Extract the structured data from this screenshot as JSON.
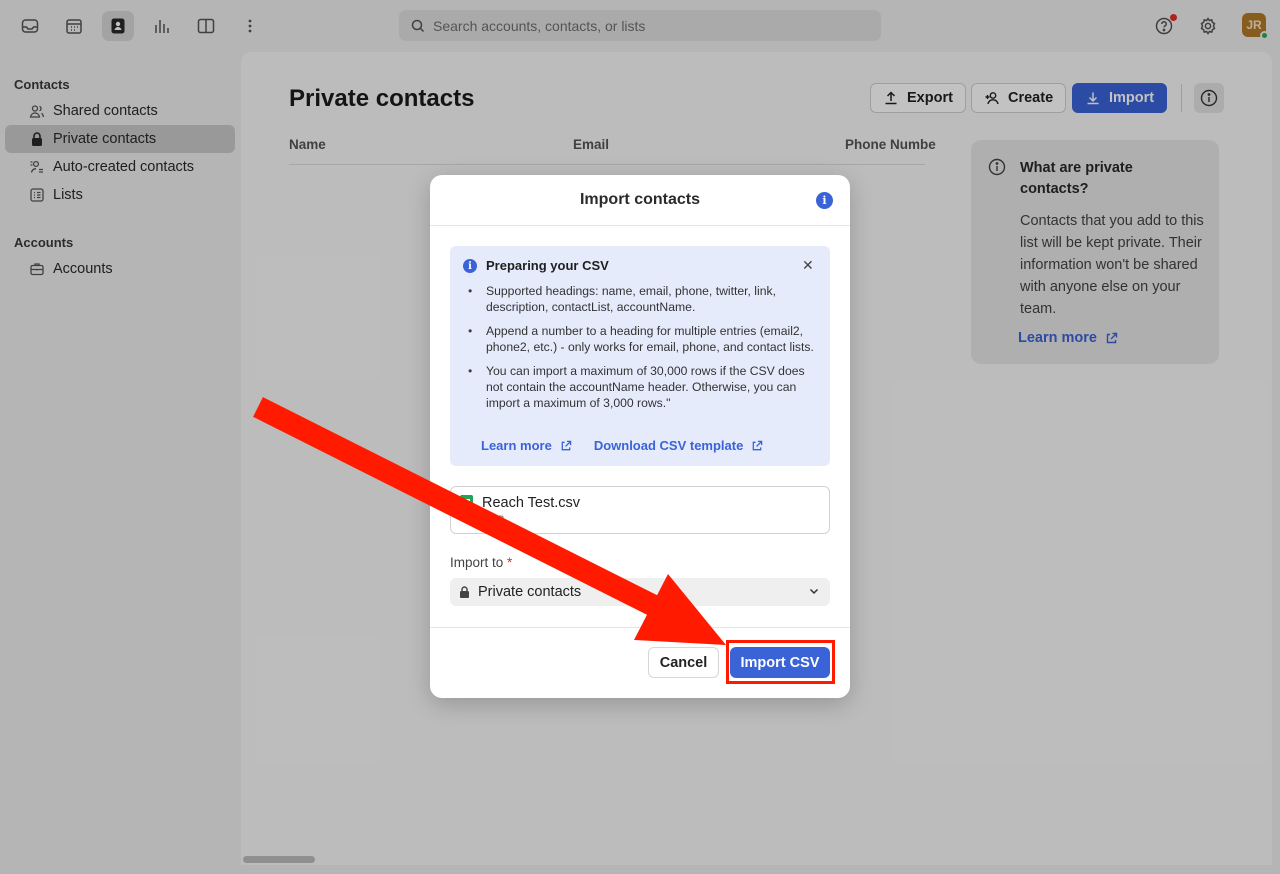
{
  "topbar": {
    "search_placeholder": "Search accounts, contacts, or lists",
    "avatar_initials": "JR",
    "nav_icons": [
      "inbox-icon",
      "calendar-icon",
      "contacts-icon",
      "analytics-icon",
      "split-view-icon",
      "more-vertical-icon"
    ],
    "right_icons": [
      "help-icon",
      "settings-icon"
    ]
  },
  "sidebar": {
    "contacts_heading": "Contacts",
    "contacts_items": [
      {
        "label": "Shared contacts",
        "icon": "users-icon"
      },
      {
        "label": "Private contacts",
        "icon": "lock-icon",
        "active": true
      },
      {
        "label": "Auto-created contacts",
        "icon": "auto-users-icon"
      },
      {
        "label": "Lists",
        "icon": "list-icon"
      }
    ],
    "accounts_heading": "Accounts",
    "accounts_items": [
      {
        "label": "Accounts",
        "icon": "briefcase-icon"
      }
    ]
  },
  "main": {
    "title": "Private contacts",
    "export_label": "Export",
    "create_label": "Create",
    "import_label": "Import",
    "columns": [
      "Name",
      "Email",
      "Phone Numbe"
    ],
    "info_card": {
      "title": "What are private contacts?",
      "body": "Contacts that you add to this list will be kept private. Their information won't be shared with anyone else on your team.",
      "link": "Learn more"
    }
  },
  "modal": {
    "title": "Import contacts",
    "csv_box": {
      "title": "Preparing your CSV",
      "bullets": [
        "Supported headings: name, email, phone, twitter, link, description, contactList, accountName.",
        "Append a number to a heading for multiple entries (email2, phone2, etc.) - only works for email, phone, and contact lists.",
        "You can import a maximum of 30,000 rows if the CSV does not contain the accountName header. Otherwise, you can import a maximum of 3,000 rows.\""
      ],
      "learn_more": "Learn more",
      "download_template": "Download CSV template"
    },
    "file": {
      "name": "Reach Test.csv",
      "size": "1MB"
    },
    "import_to_label": "Import to",
    "required_mark": "*",
    "select_value": "Private contacts",
    "cancel_label": "Cancel",
    "import_csv_label": "Import CSV"
  },
  "colors": {
    "accent": "#3b63d8",
    "annotation": "#ff1a00"
  }
}
